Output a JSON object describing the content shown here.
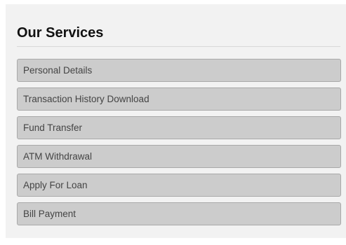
{
  "services": {
    "title": "Our Services",
    "items": [
      {
        "label": "Personal Details"
      },
      {
        "label": "Transaction History Download"
      },
      {
        "label": "Fund Transfer"
      },
      {
        "label": "ATM Withdrawal"
      },
      {
        "label": "Apply For Loan"
      },
      {
        "label": "Bill Payment"
      }
    ]
  }
}
